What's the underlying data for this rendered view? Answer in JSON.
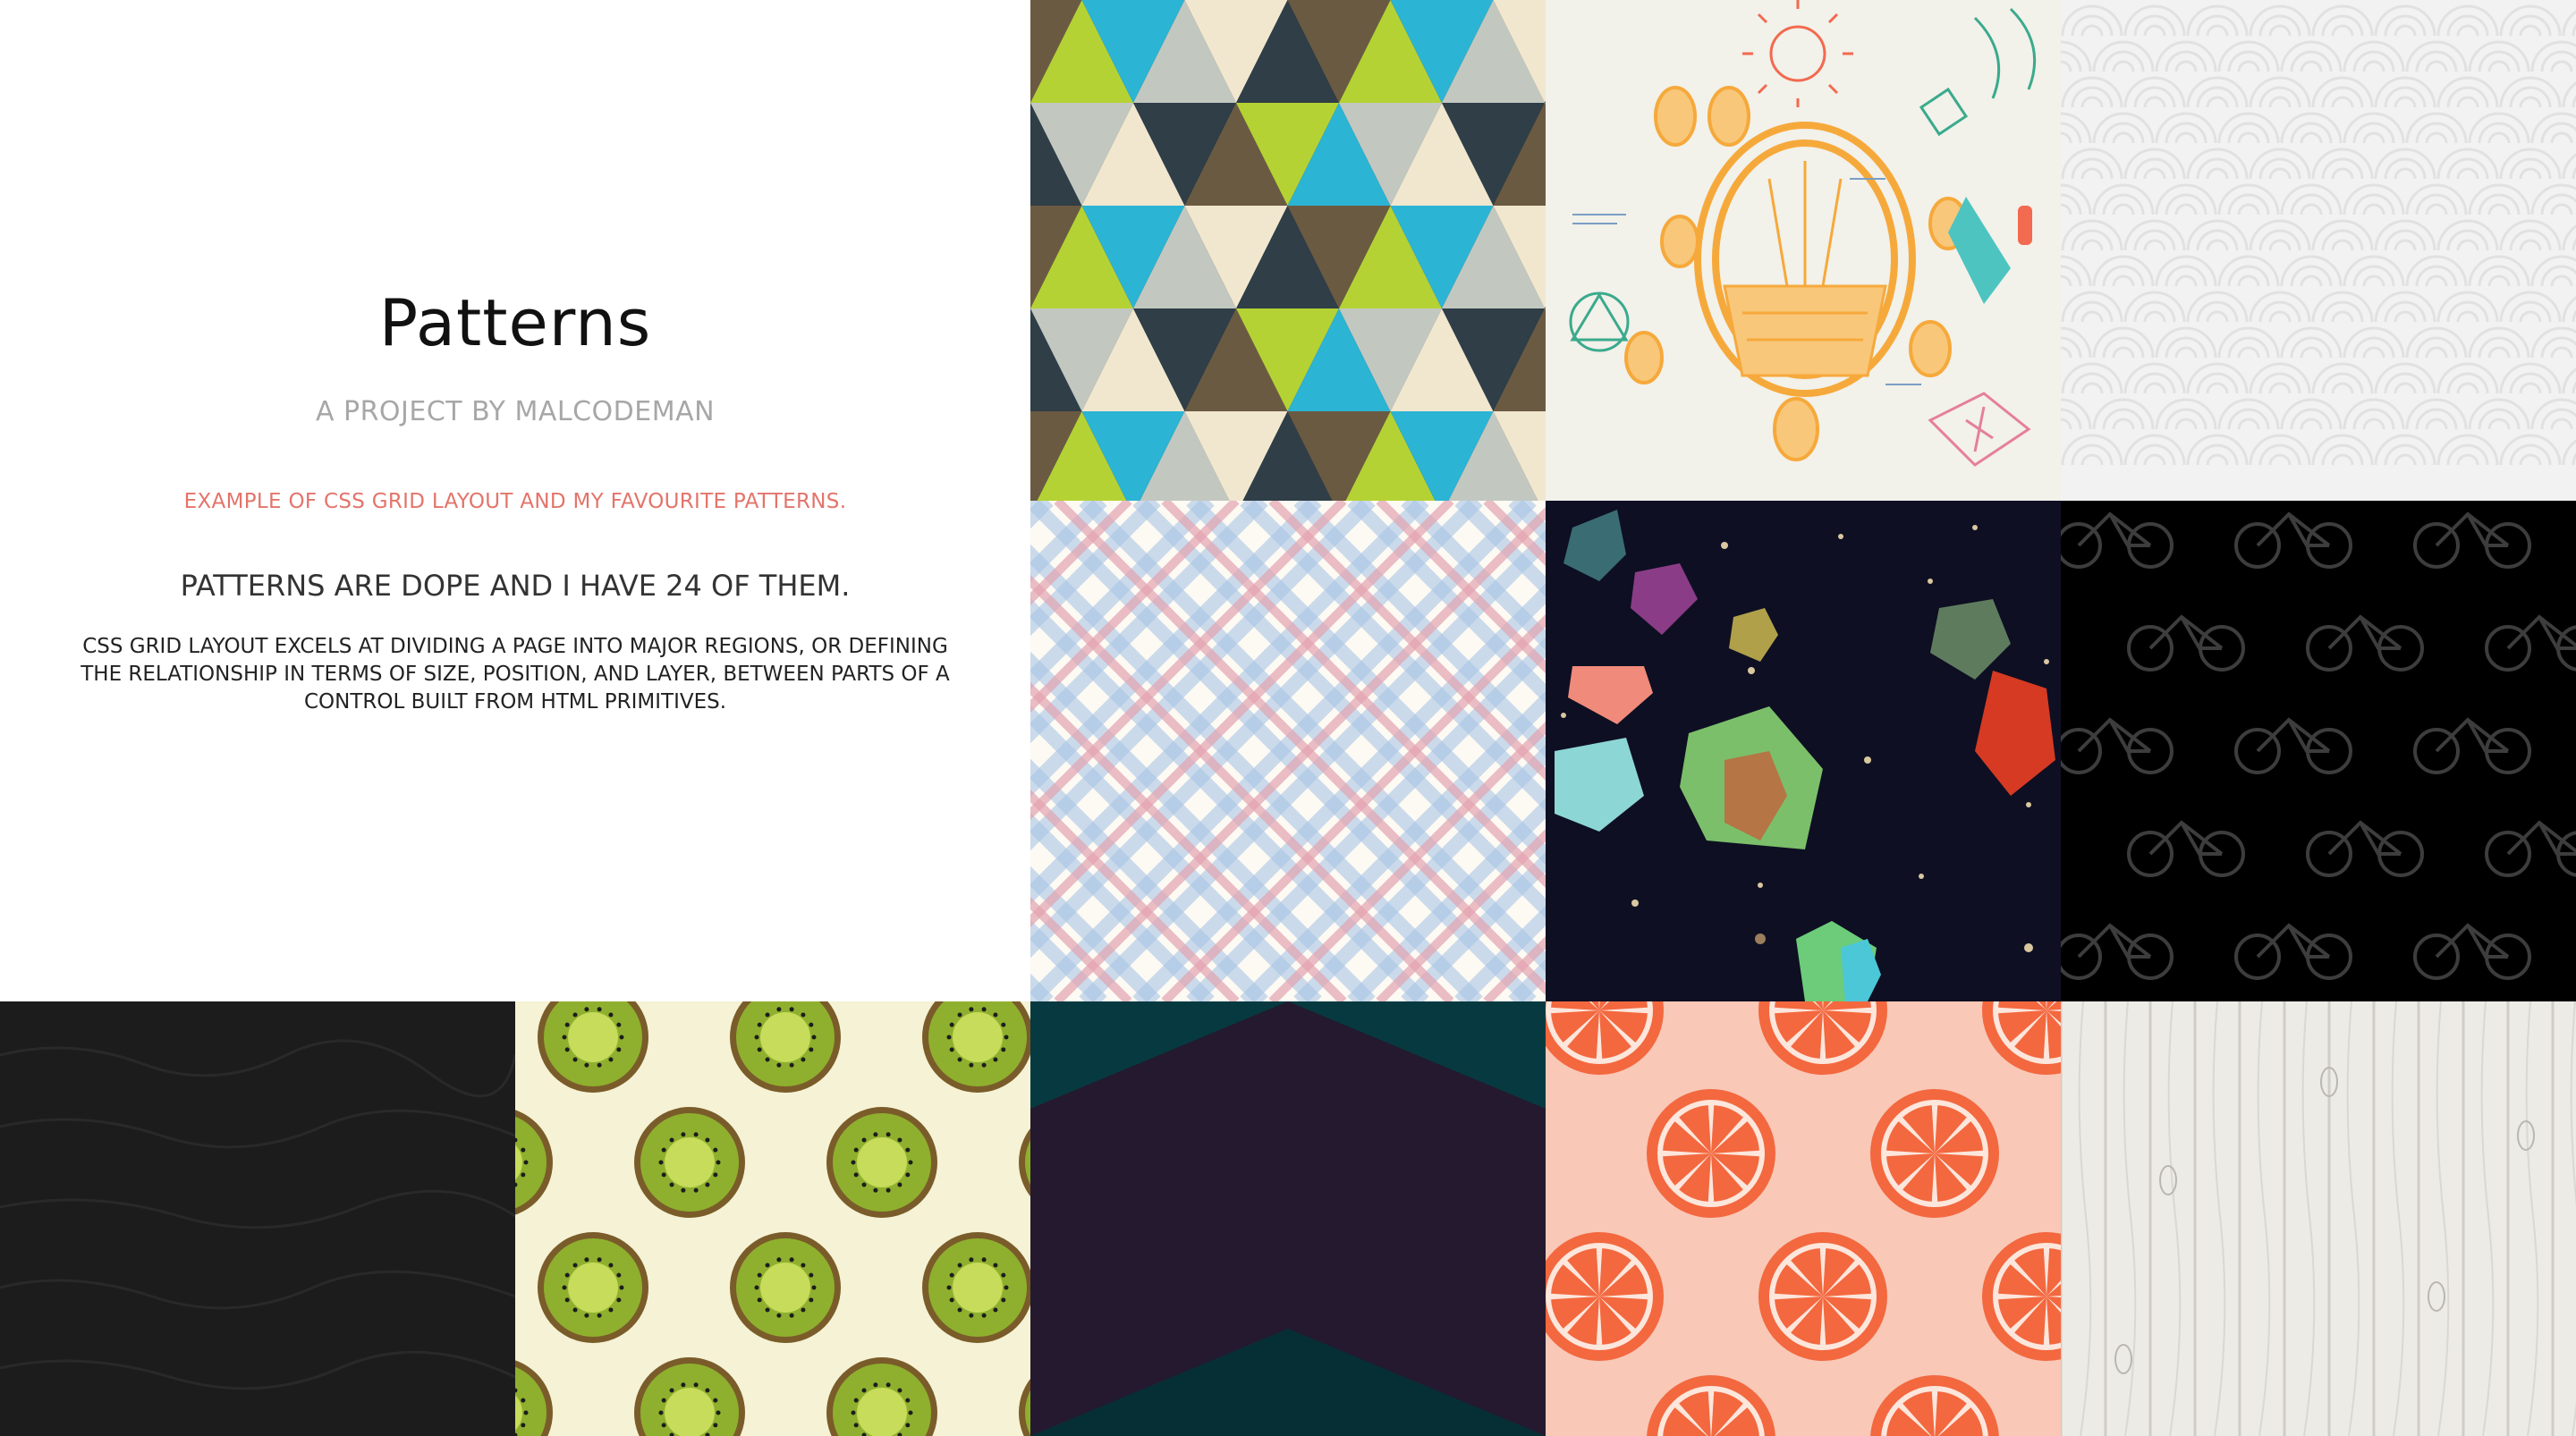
{
  "header": {
    "title": "Patterns",
    "subtitle": "A PROJECT BY MALCODEMAN",
    "tagline": "EXAMPLE OF CSS GRID LAYOUT AND MY FAVOURITE PATTERNS.",
    "heading": "PATTERNS ARE DOPE AND I HAVE 24 OF THEM.",
    "description": "CSS GRID LAYOUT EXCELS AT DIVIDING A PAGE INTO MAJOR REGIONS, OR DEFINING THE RELATIONSHIP IN TERMS OF SIZE, POSITION, AND LAYER, BETWEEN PARTS OF A CONTROL BUILT FROM HTML PRIMITIVES."
  },
  "colors": {
    "title": "#111111",
    "subtitle": "#a7a7a7",
    "tagline": "#e3746b",
    "text": "#222222"
  },
  "tiles": [
    {
      "name": "pattern-triangles",
      "colors": [
        "#2bb4d4",
        "#b5d234",
        "#6b5a42",
        "#2f3e47",
        "#f1e7cf",
        "#c2c8c0"
      ]
    },
    {
      "name": "pattern-botanical-sketch",
      "colors": [
        "#f2f1ea",
        "#f6a93b",
        "#f26a4f",
        "#3aaa8c"
      ]
    },
    {
      "name": "pattern-seigaiha-waves",
      "colors": [
        "#f2f2f2",
        "#e2e2e2"
      ]
    },
    {
      "name": "pattern-plaid",
      "colors": [
        "#fdfaf3",
        "#a9c6e6",
        "#e3a3b0"
      ]
    },
    {
      "name": "pattern-space-gems",
      "colors": [
        "#0e0f22",
        "#8dd6d6",
        "#f08a7a",
        "#7bbf6a",
        "#e04a2f"
      ]
    },
    {
      "name": "pattern-bicycles",
      "colors": [
        "#000000",
        "#3d3d3d"
      ]
    },
    {
      "name": "pattern-dark-texture",
      "colors": [
        "#1c1c1c",
        "#2a2a2a"
      ]
    },
    {
      "name": "pattern-kiwi-slices",
      "colors": [
        "#f5f2d5",
        "#8fb02e",
        "#c6dc5a",
        "#7a5c2a"
      ]
    },
    {
      "name": "pattern-chevrons",
      "colors": [
        "#25192f",
        "#052f34"
      ]
    },
    {
      "name": "pattern-grapefruit",
      "colors": [
        "#f9c8b7",
        "#f3683f",
        "#fde6dc"
      ]
    },
    {
      "name": "pattern-white-wood",
      "colors": [
        "#ecebe6",
        "#c8c6bf"
      ]
    }
  ]
}
